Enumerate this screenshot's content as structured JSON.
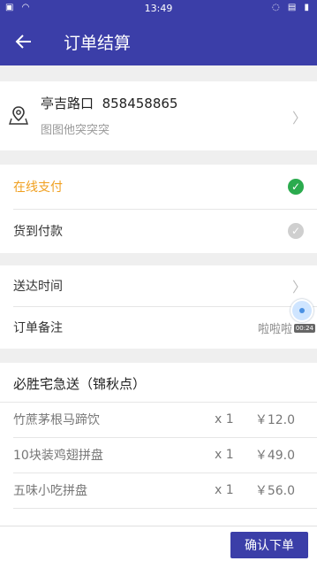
{
  "status_bar": {
    "time": "13:49"
  },
  "app_bar": {
    "title": "订单结算"
  },
  "address": {
    "name": "亭吉路口",
    "phone": "858458865",
    "detail": "图图他突突突"
  },
  "payment": {
    "online": "在线支付",
    "cod": "货到付款",
    "online_color": "#f0a020",
    "check_active_color": "#2bab4e",
    "check_inactive_color": "#cfcfcf"
  },
  "misc": {
    "delivery_time_label": "送达时间",
    "note_label": "订单备注",
    "note_value": "啦啦啦",
    "overlay_time": "00:24"
  },
  "order": {
    "shop_name": "必胜宅急送（锦秋点）",
    "items": [
      {
        "name": "竹蔗茅根马蹄饮",
        "qty": "x 1",
        "price": "￥12.0"
      },
      {
        "name": "10块装鸡翅拼盘",
        "qty": "x 1",
        "price": "￥49.0"
      },
      {
        "name": "五味小吃拼盘",
        "qty": "x 1",
        "price": "￥56.0"
      }
    ]
  },
  "bottom": {
    "confirm_label": "确认下单"
  }
}
